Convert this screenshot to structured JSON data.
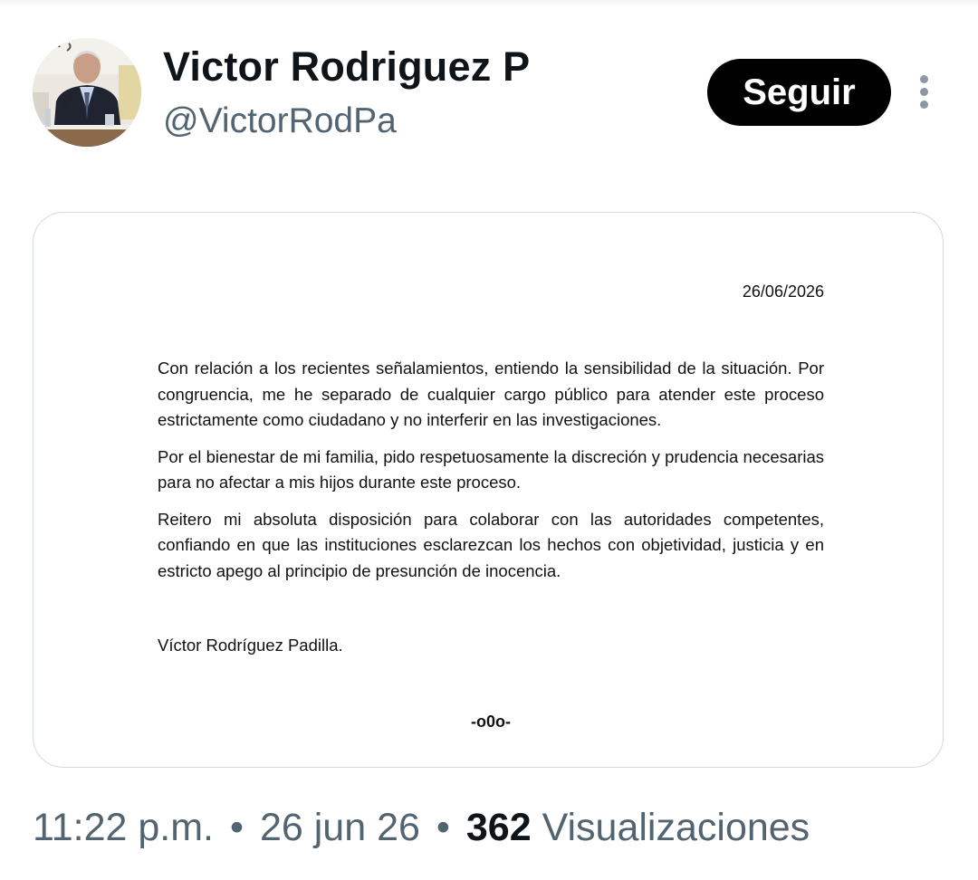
{
  "header": {
    "display_name": "Victor Rodriguez P",
    "handle": "@VictorRodPa",
    "follow_label": "Seguir"
  },
  "icons": {
    "avatar": "profile-photo",
    "more": "more-options-icon"
  },
  "statement": {
    "date": "26/06/2026",
    "paragraphs": [
      "Con relación a los recientes señalamientos, entiendo la sensibilidad de la situación. Por congruencia, me he separado de cualquier cargo público para atender este proceso estrictamente como ciudadano y no interferir en las investigaciones.",
      "Por el bienestar de mi familia, pido respetuosamente la discreción y prudencia necesarias para no afectar a mis hijos durante este proceso.",
      "Reitero mi absoluta disposición para colaborar con las autoridades competentes, confiando en que las instituciones esclarezcan los hechos con objetividad, justicia y en estricto apego al principio de presunción de inocencia."
    ],
    "signature": "Víctor Rodríguez Padilla.",
    "closing": "-o0o-"
  },
  "meta": {
    "time": "11:22 p.m.",
    "date": "26 jun 26",
    "separator": "•",
    "views_count": "362",
    "views_label": "Visualizaciones"
  },
  "colors": {
    "text_primary": "#0f1419",
    "text_secondary": "#536471",
    "border": "#cfd9de",
    "button_bg": "#000000"
  }
}
